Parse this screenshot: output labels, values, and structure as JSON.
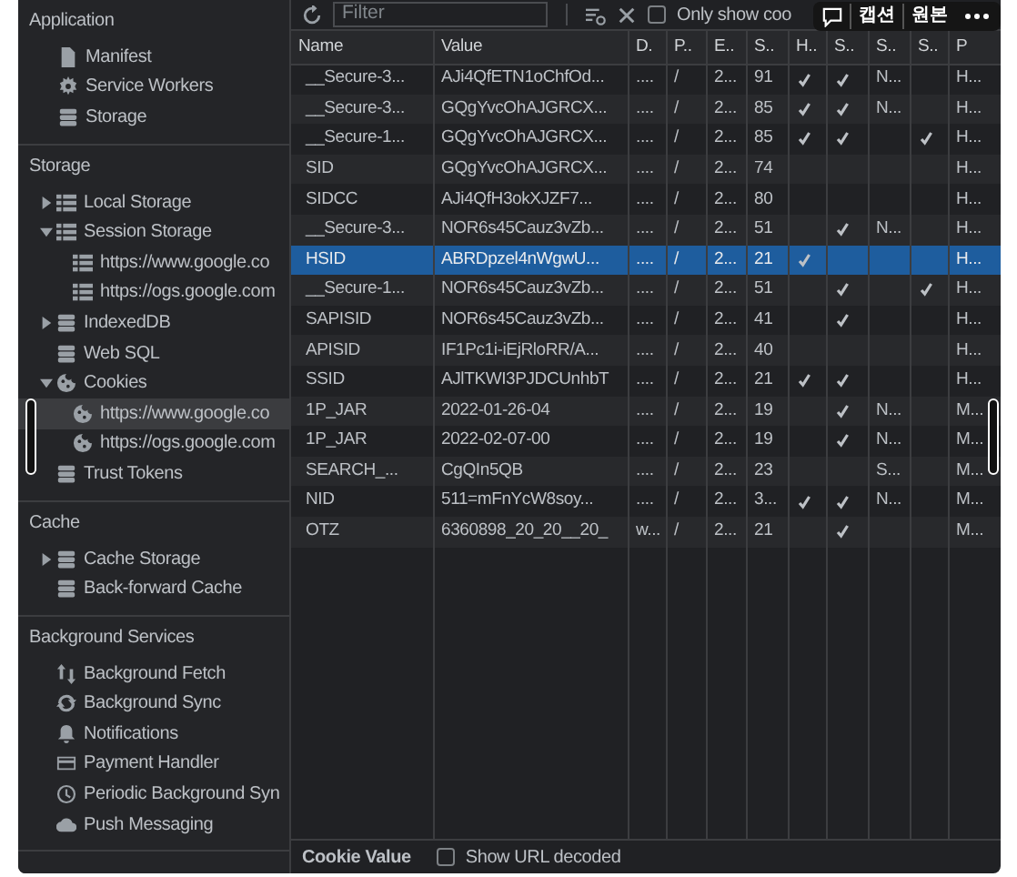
{
  "sidebar": {
    "sections": [
      {
        "title": "Application",
        "items": [
          {
            "label": "Manifest",
            "kind": "file",
            "selected": false
          },
          {
            "label": "Service Workers",
            "kind": "gear",
            "selected": false
          },
          {
            "label": "Storage",
            "kind": "database",
            "selected": false
          }
        ]
      },
      {
        "title": "Storage",
        "items": [
          {
            "label": "Local Storage",
            "kind": "grid",
            "expanded": false,
            "selected": false
          },
          {
            "label": "Session Storage",
            "kind": "grid",
            "expanded": true,
            "selected": false,
            "children": [
              {
                "label": "https://www.google.co",
                "kind": "grid",
                "selected": false
              },
              {
                "label": "https://ogs.google.com",
                "kind": "grid",
                "selected": false
              }
            ]
          },
          {
            "label": "IndexedDB",
            "kind": "database",
            "expanded": false,
            "selected": false
          },
          {
            "label": "Web SQL",
            "kind": "database",
            "selected": false
          },
          {
            "label": "Cookies",
            "kind": "cookie",
            "expanded": true,
            "selected": false,
            "children": [
              {
                "label": "https://www.google.co",
                "kind": "cookie",
                "selected": true
              },
              {
                "label": "https://ogs.google.com",
                "kind": "cookie",
                "selected": false
              }
            ]
          },
          {
            "label": "Trust Tokens",
            "kind": "database",
            "selected": false
          }
        ]
      },
      {
        "title": "Cache",
        "items": [
          {
            "label": "Cache Storage",
            "kind": "database",
            "expanded": false,
            "selected": false
          },
          {
            "label": "Back-forward Cache",
            "kind": "database",
            "selected": false
          }
        ]
      },
      {
        "title": "Background Services",
        "items": [
          {
            "label": "Background Fetch",
            "kind": "arrows",
            "selected": false
          },
          {
            "label": "Background Sync",
            "kind": "sync",
            "selected": false
          },
          {
            "label": "Notifications",
            "kind": "bell",
            "selected": false
          },
          {
            "label": "Payment Handler",
            "kind": "card",
            "selected": false
          },
          {
            "label": "Periodic Background Syn",
            "kind": "clock",
            "selected": false
          },
          {
            "label": "Push Messaging",
            "kind": "cloud",
            "selected": false
          }
        ]
      }
    ]
  },
  "toolbar": {
    "filter_placeholder": "Filter",
    "only_issues": {
      "label": "Only show coo",
      "checked": false
    }
  },
  "table": {
    "columns": [
      "Name",
      "Value",
      "D.",
      "P..",
      "E..",
      "S..",
      "H..",
      "S..",
      "S..",
      "S..",
      "P"
    ],
    "rows": [
      {
        "name": "__Secure-3...",
        "value": "AJi4QfETN1oChfOd...",
        "domain": "....",
        "path": "/",
        "expires": "2...",
        "size": "91",
        "httponly": true,
        "secure": true,
        "samesite": "N...",
        "sameparty": false,
        "priority": "H...",
        "selected": false
      },
      {
        "name": "__Secure-3...",
        "value": "GQgYvcOhAJGRCX...",
        "domain": "....",
        "path": "/",
        "expires": "2...",
        "size": "85",
        "httponly": true,
        "secure": true,
        "samesite": "N...",
        "sameparty": false,
        "priority": "H...",
        "selected": false
      },
      {
        "name": "__Secure-1...",
        "value": "GQgYvcOhAJGRCX...",
        "domain": "....",
        "path": "/",
        "expires": "2...",
        "size": "85",
        "httponly": true,
        "secure": true,
        "sameparty": true,
        "priority": "H...",
        "selected": false
      },
      {
        "name": "SID",
        "value": "GQgYvcOhAJGRCX...",
        "domain": "....",
        "path": "/",
        "expires": "2...",
        "size": "74",
        "httponly": false,
        "secure": false,
        "sameparty": false,
        "priority": "H...",
        "selected": false
      },
      {
        "name": "SIDCC",
        "value": "AJi4QfH3okXJZF7...",
        "domain": "....",
        "path": "/",
        "expires": "2...",
        "size": "80",
        "httponly": false,
        "secure": false,
        "sameparty": false,
        "priority": "H...",
        "selected": false
      },
      {
        "name": "__Secure-3...",
        "value": "NOR6s45Cauz3vZb...",
        "domain": "....",
        "path": "/",
        "expires": "2...",
        "size": "51",
        "httponly": false,
        "secure": true,
        "samesite": "N...",
        "sameparty": false,
        "priority": "H...",
        "selected": false
      },
      {
        "name": "HSID",
        "value": "ABRDpzel4nWgwU...",
        "domain": "....",
        "path": "/",
        "expires": "2...",
        "size": "21",
        "httponly": true,
        "secure": false,
        "sameparty": false,
        "priority": "H...",
        "selected": true
      },
      {
        "name": "__Secure-1...",
        "value": "NOR6s45Cauz3vZb...",
        "domain": "....",
        "path": "/",
        "expires": "2...",
        "size": "51",
        "httponly": false,
        "secure": true,
        "sameparty": true,
        "priority": "H...",
        "selected": false
      },
      {
        "name": "SAPISID",
        "value": "NOR6s45Cauz3vZb...",
        "domain": "....",
        "path": "/",
        "expires": "2...",
        "size": "41",
        "httponly": false,
        "secure": true,
        "sameparty": false,
        "priority": "H...",
        "selected": false
      },
      {
        "name": "APISID",
        "value": "IF1Pc1i-iEjRloRR/A...",
        "domain": "....",
        "path": "/",
        "expires": "2...",
        "size": "40",
        "httponly": false,
        "secure": false,
        "sameparty": false,
        "priority": "H...",
        "selected": false
      },
      {
        "name": "SSID",
        "value": "AJlTKWI3PJDCUnhbT",
        "domain": "....",
        "path": "/",
        "expires": "2...",
        "size": "21",
        "httponly": true,
        "secure": true,
        "sameparty": false,
        "priority": "H...",
        "selected": false
      },
      {
        "name": "1P_JAR",
        "value": "2022-01-26-04",
        "domain": "....",
        "path": "/",
        "expires": "2...",
        "size": "19",
        "httponly": false,
        "secure": true,
        "samesite": "N...",
        "sameparty": false,
        "priority": "M...",
        "selected": false
      },
      {
        "name": "1P_JAR",
        "value": "2022-02-07-00",
        "domain": "....",
        "path": "/",
        "expires": "2...",
        "size": "19",
        "httponly": false,
        "secure": true,
        "samesite": "N...",
        "sameparty": false,
        "priority": "M...",
        "selected": false
      },
      {
        "name": "SEARCH_...",
        "value": "CgQIn5QB",
        "domain": "....",
        "path": "/",
        "expires": "2...",
        "size": "23",
        "httponly": false,
        "secure": false,
        "samesite": "S...",
        "sameparty": false,
        "priority": "M...",
        "selected": false
      },
      {
        "name": "NID",
        "value": "511=mFnYcW8soy...",
        "domain": "....",
        "path": "/",
        "expires": "2...",
        "size": "3...",
        "httponly": true,
        "secure": true,
        "samesite": "N...",
        "sameparty": false,
        "priority": "M...",
        "selected": false
      },
      {
        "name": "OTZ",
        "value": "6360898_20_20__20_",
        "domain": "w...",
        "path": "/",
        "expires": "2...",
        "size": "21",
        "httponly": false,
        "secure": true,
        "sameparty": false,
        "priority": "M...",
        "selected": false
      }
    ]
  },
  "bottom_bar": {
    "title": "Cookie Value",
    "url_decoded": {
      "label": "Show URL decoded",
      "checked": false
    }
  },
  "viewer_overlay": {
    "caption_button": "캡션",
    "original_button": "원본"
  }
}
